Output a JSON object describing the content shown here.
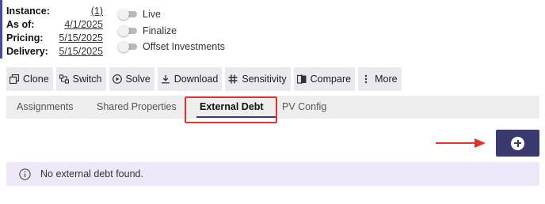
{
  "details": {
    "instance": {
      "label": "Instance:",
      "value": "(1)"
    },
    "as_of": {
      "label": "As of:",
      "value": "4/1/2025"
    },
    "pricing": {
      "label": "Pricing:",
      "value": "5/15/2025"
    },
    "delivery": {
      "label": "Delivery:",
      "value": "5/15/2025"
    }
  },
  "toggles": {
    "live": {
      "label": "Live",
      "on": false
    },
    "finalize": {
      "label": "Finalize",
      "on": false
    },
    "offset": {
      "label": "Offset Investments",
      "on": false
    }
  },
  "toolbar": {
    "clone": {
      "label": "Clone",
      "icon": "copy-icon"
    },
    "switch": {
      "label": "Switch",
      "icon": "switch-icon"
    },
    "solve": {
      "label": "Solve",
      "icon": "play-icon"
    },
    "download": {
      "label": "Download",
      "icon": "download-icon"
    },
    "sensitivity": {
      "label": "Sensitivity",
      "icon": "grid-icon"
    },
    "compare": {
      "label": "Compare",
      "icon": "compare-icon"
    },
    "more": {
      "label": "More",
      "icon": "more-vertical-icon"
    }
  },
  "tabs": [
    {
      "label": "Assignments"
    },
    {
      "label": "Shared Properties"
    },
    {
      "label": "External Debt",
      "active": true
    },
    {
      "label": "PV Config"
    }
  ],
  "external_debt": {
    "add_icon": "add-circle-icon",
    "empty_message": "No external debt found."
  },
  "colors": {
    "primary": "#3a3a6e",
    "annotation": "#e0332b",
    "banner_bg": "#efe8f8",
    "toolbar_bg": "#e9e9ee"
  }
}
